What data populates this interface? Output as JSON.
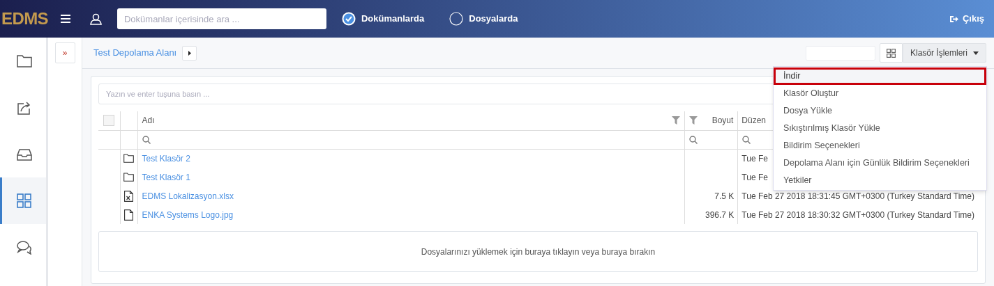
{
  "topbar": {
    "logo": "EDMS",
    "search": {
      "placeholder": "Dokümanlar içerisinde ara ..."
    },
    "scopes": [
      {
        "label": "Dokümanlarda",
        "selected": true
      },
      {
        "label": "Dosyalarda",
        "selected": false
      }
    ],
    "logout": "Çıkış"
  },
  "sidebar": {
    "items": [
      {
        "kind": "folder",
        "selected": false
      },
      {
        "kind": "share",
        "selected": false
      },
      {
        "kind": "inbox",
        "selected": false
      },
      {
        "kind": "grid",
        "selected": true
      },
      {
        "kind": "chat",
        "selected": false
      }
    ]
  },
  "expand_button": "»",
  "breadcrumb": {
    "items": [
      "Test Depolama Alanı"
    ]
  },
  "toolbar": {
    "menu_button": "Klasör İşlemleri"
  },
  "filter": {
    "placeholder": "Yazın ve enter tuşuna basın ..."
  },
  "table": {
    "select_all": {
      "checked": false
    },
    "columns": [
      "Adı",
      "Boyut",
      "Düzen"
    ],
    "rows": [
      {
        "kind": "folder",
        "name": "Test Klasör 2",
        "size": "",
        "date": "Tue Fe"
      },
      {
        "kind": "folder",
        "name": "Test Klasör 1",
        "size": "",
        "date": "Tue Fe"
      },
      {
        "kind": "excel",
        "name": "EDMS Lokalizasyon.xlsx",
        "size": "7.5 K",
        "date": "Tue Feb 27 2018 18:31:45 GMT+0300 (Turkey Standard Time)"
      },
      {
        "kind": "file",
        "name": "ENKA Systems Logo.jpg",
        "size": "396.7 K",
        "date": "Tue Feb 27 2018 18:30:32 GMT+0300 (Turkey Standard Time)"
      }
    ]
  },
  "dropzone": "Dosyalarınızı yüklemek için buraya tıklayın veya buraya bırakın",
  "menu": {
    "items": [
      {
        "label": "İndir",
        "selected": true
      },
      {
        "label": "Klasör Oluştur",
        "selected": false
      },
      {
        "label": "Dosya Yükle",
        "selected": false
      },
      {
        "label": "Sıkıştırılmış Klasör Yükle",
        "selected": false
      },
      {
        "label": "Bildirim Seçenekleri",
        "selected": false
      },
      {
        "label": "Depolama Alanı için Günlük Bildirim Seçenekleri",
        "selected": false
      },
      {
        "label": "Yetkiler",
        "selected": false
      }
    ]
  }
}
